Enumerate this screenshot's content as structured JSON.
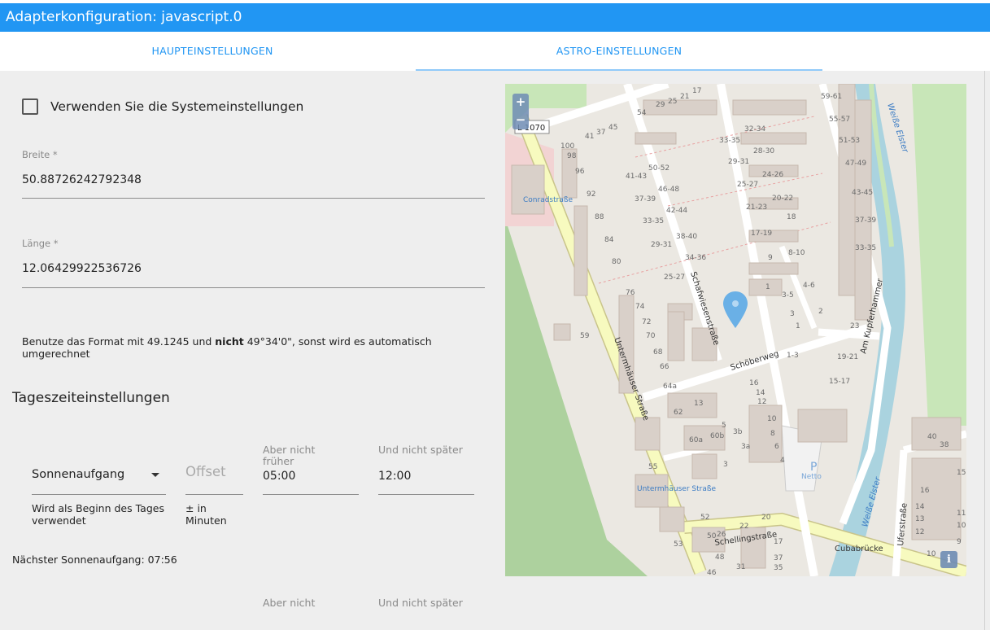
{
  "window": {
    "title": "Adapterkonfiguration: javascript.0"
  },
  "tabs": [
    {
      "label": "HAUPTEINSTELLUNGEN"
    },
    {
      "label": "ASTRO-EINSTELLUNGEN"
    }
  ],
  "astro": {
    "use_system_label": "Verwenden Sie die Systemeinstellungen",
    "latitude": {
      "label": "Breite *",
      "value": "50.88726242792348"
    },
    "longitude": {
      "label": "Länge *",
      "value": "12.06429922536726"
    },
    "hint_part1": "Benutze das Format mit 49.1245 und ",
    "hint_bold": "nicht",
    "hint_part2": " 49°34'0\", sonst wird es automatisch umgerechnet",
    "section_title": "Tageszeiteinstellungen",
    "row1": {
      "event": "Sonnenaufgang",
      "event_helper": "Wird als Beginn des Tages verwendet",
      "offset_placeholder": "Offset",
      "offset_helper": "± in Minuten",
      "not_earlier_label": "Aber nicht früher",
      "not_earlier_value": "05:00",
      "not_later_label": "Und nicht später",
      "not_later_value": "12:00"
    },
    "next_sunrise": "Nächster Sonnenaufgang: 07:56",
    "row2": {
      "not_earlier_label": "Aber nicht",
      "not_later_label": "Und nicht später"
    }
  },
  "map": {
    "zoom_in": "+",
    "zoom_out": "−",
    "info": "i",
    "road_ref": "L 1070",
    "streets": [
      "Untermhäuser Straße",
      "Schafwiesenstraße",
      "Schöberweg",
      "Schellingstraße",
      "Cubabrücke",
      "Am Kupferhammer",
      "Uferstraße",
      "Weiße Elster"
    ],
    "stops": [
      "Conradstraße",
      "Untermhäuser Straße"
    ],
    "poi": [
      "Netto"
    ],
    "house_numbers": [
      "59-61",
      "55-57",
      "51-53",
      "47-49",
      "43-45",
      "37-39",
      "33-35",
      "32-34",
      "28-30",
      "24-26",
      "20-22",
      "18",
      "8-10",
      "4-6",
      "3-5",
      "2",
      "1-3",
      "19-21",
      "15-17",
      "23",
      "33-35",
      "29-31",
      "25-27",
      "21-23",
      "17-19",
      "9",
      "1",
      "3",
      "4",
      "50-52",
      "46-48",
      "42-44",
      "38-40",
      "34-36",
      "41-43",
      "37-39",
      "33-35",
      "29-31",
      "25-27",
      "100",
      "98",
      "96",
      "92",
      "88",
      "84",
      "80",
      "76",
      "74",
      "72",
      "70",
      "68",
      "66",
      "64a",
      "62",
      "60a",
      "60b",
      "59",
      "55",
      "53",
      "52",
      "50",
      "26",
      "22",
      "20",
      "17",
      "37",
      "35",
      "31",
      "48",
      "46",
      "13",
      "16",
      "14",
      "12",
      "10",
      "8",
      "6",
      "4",
      "5",
      "3b",
      "3a",
      "54",
      "29",
      "25",
      "21",
      "17",
      "41",
      "37",
      "45",
      "40",
      "38",
      "16",
      "14",
      "13",
      "12",
      "11",
      "10",
      "9",
      "15"
    ],
    "colors": {
      "river": "#aad3df",
      "park": "#c8e6b8",
      "wood": "#add19e",
      "main_road": "#f7fabf",
      "background": "#f1eee8"
    }
  }
}
